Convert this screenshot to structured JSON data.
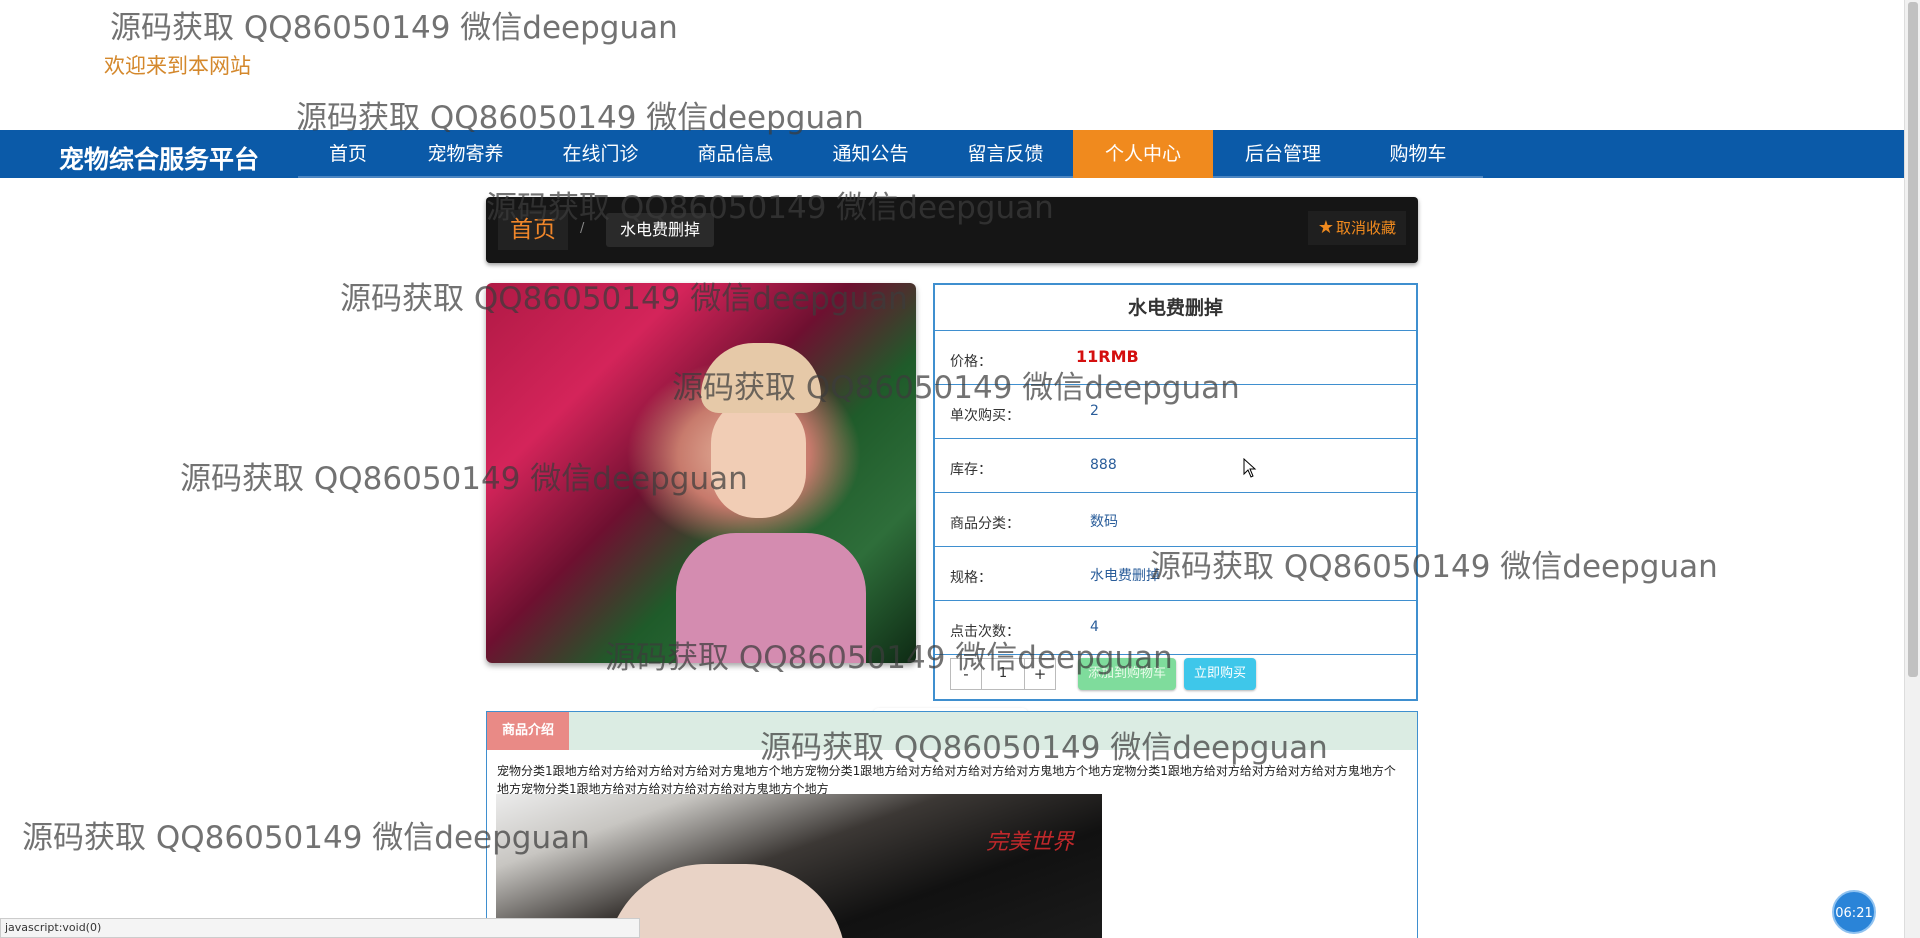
{
  "watermark_text": "源码获取 QQ86050149 微信deepguan",
  "header": {
    "welcome": "欢迎来到本网站"
  },
  "nav": {
    "brand": "宠物综合服务平台",
    "items": [
      {
        "label": "首页"
      },
      {
        "label": "宠物寄养"
      },
      {
        "label": "在线门诊"
      },
      {
        "label": "商品信息"
      },
      {
        "label": "通知公告"
      },
      {
        "label": "留言反馈"
      },
      {
        "label": "个人中心"
      },
      {
        "label": "后台管理"
      },
      {
        "label": "购物车"
      }
    ],
    "active_item": "个人中心"
  },
  "breadcrumb": {
    "home": "首页",
    "separator": "/",
    "current": "水电费删掉",
    "favorite_label": "取消收藏"
  },
  "product": {
    "title": "水电费删掉",
    "rows": [
      {
        "label": "价格：",
        "value": "11RMB"
      },
      {
        "label": "单次购买：",
        "value": "2"
      },
      {
        "label": "库存：",
        "value": "888"
      },
      {
        "label": "商品分类：",
        "value": "数码"
      },
      {
        "label": "规格：",
        "value": "水电费删掉"
      },
      {
        "label": "点击次数：",
        "value": "4"
      }
    ],
    "quantity": {
      "minus": "-",
      "value": "1",
      "plus": "+"
    },
    "add_to_cart": "添加到购物车",
    "buy_now": "立即购买"
  },
  "intro": {
    "tab_label": "商品介绍",
    "text": "宠物分类1跟地方给对方给对方给对方给对方鬼地方个地方宠物分类1跟地方给对方给对方给对方给对方鬼地方个地方宠物分类1跟地方给对方给对方给对方给对方鬼地方个地方宠物分类1跟地方给对方给对方给对方给对方鬼地方个地方",
    "image_logo": "完美世界"
  },
  "status_bar": "javascript:void(0)",
  "timer": "06:21",
  "colors": {
    "nav_bg": "#0b5aa8",
    "nav_active": "#f08a1e",
    "price": "#d40f0f",
    "panel_border": "#3f8fcf"
  }
}
